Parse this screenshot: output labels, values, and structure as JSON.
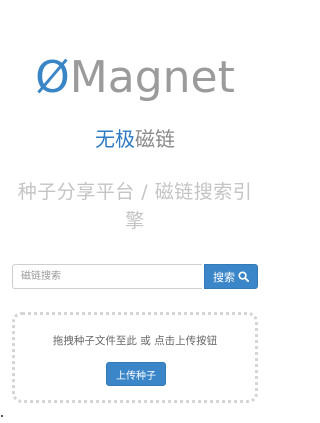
{
  "header": {
    "logo_symbol": "Ø",
    "logo_word": "Magnet"
  },
  "brand": {
    "accent": "无极",
    "rest": "磁链"
  },
  "tagline": "种子分享平台 / 磁链搜索引擎",
  "search": {
    "placeholder": "磁链搜索",
    "button_label": "搜索",
    "button_icon": "search-icon"
  },
  "upload": {
    "hint": "拖拽种子文件至此 或 点击上传按钮",
    "button_label": "上传种子"
  },
  "colors": {
    "accent": "#3a86c8",
    "logo_gray": "#9b9b9b",
    "tagline_gray": "#c4c4c4",
    "dotted_border": "#d5d5d5"
  }
}
